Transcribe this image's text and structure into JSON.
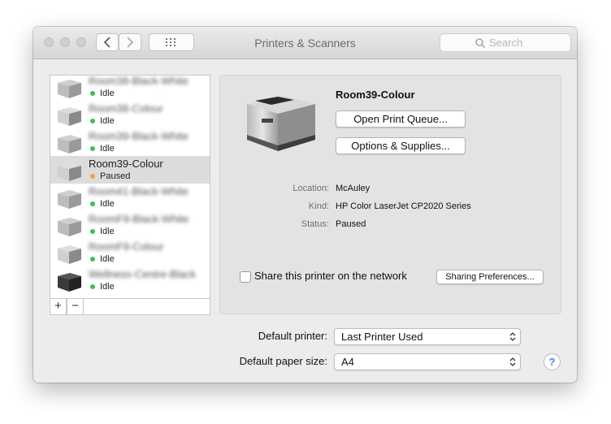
{
  "window": {
    "title": "Printers & Scanners"
  },
  "search": {
    "placeholder": "Search"
  },
  "printers": [
    {
      "name": "Room38-Black-White",
      "status": "Idle",
      "status_color": "#3cc24a",
      "blurred": true,
      "icon": "printer-gray-icon"
    },
    {
      "name": "Room38-Colour",
      "status": "Idle",
      "status_color": "#3cc24a",
      "blurred": true,
      "icon": "printer-color-icon"
    },
    {
      "name": "Room39-Black-White",
      "status": "Idle",
      "status_color": "#3cc24a",
      "blurred": true,
      "icon": "printer-gray-icon"
    },
    {
      "name": "Room39-Colour",
      "status": "Paused",
      "status_color": "#f0a92a",
      "blurred": false,
      "selected": true,
      "icon": "printer-color-icon"
    },
    {
      "name": "Room41-Black-White",
      "status": "Idle",
      "status_color": "#3cc24a",
      "blurred": true,
      "icon": "printer-gray-icon"
    },
    {
      "name": "RoomF9-Black-White",
      "status": "Idle",
      "status_color": "#3cc24a",
      "blurred": true,
      "icon": "printer-gray-icon"
    },
    {
      "name": "RoomF9-Colour",
      "status": "Idle",
      "status_color": "#3cc24a",
      "blurred": true,
      "icon": "printer-color-icon"
    },
    {
      "name": "Wellness-Centre-Black",
      "status": "Idle",
      "status_color": "#3cc24a",
      "blurred": true,
      "icon": "printer-black-icon"
    }
  ],
  "list_buttons": {
    "add": "+",
    "remove": "−"
  },
  "detail": {
    "name": "Room39-Colour",
    "open_queue": "Open Print Queue...",
    "options": "Options & Supplies...",
    "location_label": "Location:",
    "location": "McAuley",
    "kind_label": "Kind:",
    "kind": "HP Color LaserJet CP2020 Series",
    "status_label": "Status:",
    "status": "Paused",
    "share_label": "Share this printer on the network",
    "share_checked": false,
    "sharing_prefs": "Sharing Preferences..."
  },
  "defaults": {
    "printer_label": "Default printer:",
    "printer_value": "Last Printer Used",
    "paper_label": "Default paper size:",
    "paper_value": "A4"
  },
  "help": "?"
}
